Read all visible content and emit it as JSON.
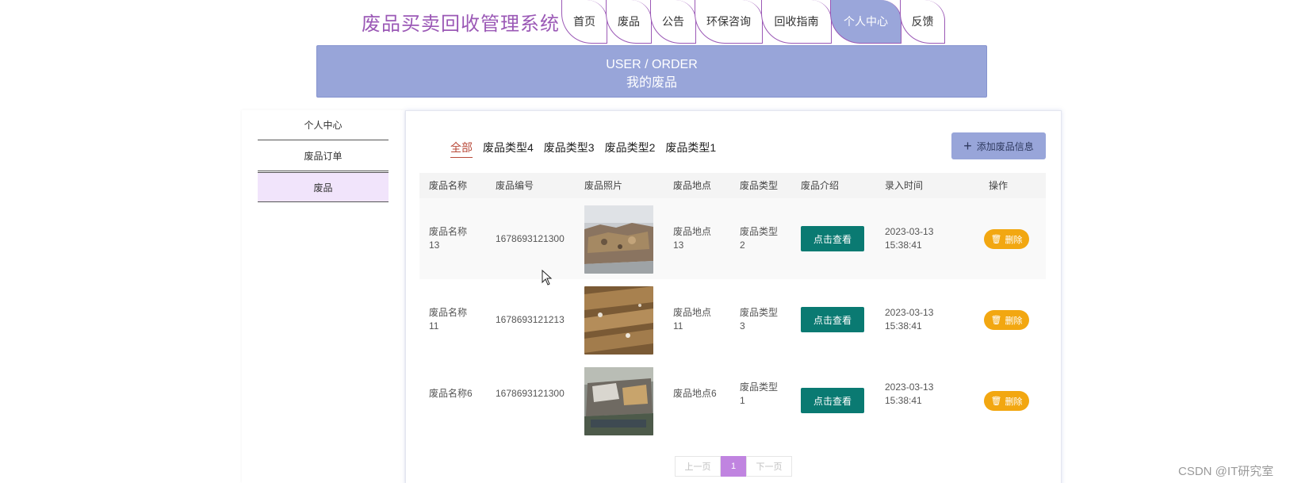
{
  "header": {
    "title": "废品买卖回收管理系统",
    "nav": [
      "首页",
      "废品",
      "公告",
      "环保咨询",
      "回收指南",
      "个人中心",
      "反馈"
    ],
    "active_nav": "个人中心"
  },
  "banner": {
    "line1": "USER / ORDER",
    "line2": "我的废品"
  },
  "sidebar": {
    "items": [
      {
        "label": "个人中心"
      },
      {
        "label": "废品订单"
      },
      {
        "label": "废品",
        "active": true
      }
    ]
  },
  "main": {
    "tabs": [
      "全部",
      "废品类型4",
      "废品类型3",
      "废品类型2",
      "废品类型1"
    ],
    "active_tab": "全部",
    "add_button": "添加废品信息",
    "columns": [
      "废品名称",
      "废品编号",
      "废品照片",
      "废品地点",
      "废品类型",
      "废品介绍",
      "录入时间",
      "操作"
    ],
    "rows": [
      {
        "name": [
          "废品名称",
          "13"
        ],
        "code": "1678693121300",
        "location": [
          "废品地点",
          "13"
        ],
        "type": [
          "废品类型",
          "2"
        ],
        "view": "点击查看",
        "time": [
          "2023-03-13",
          "15:38:41"
        ],
        "delete": "删除"
      },
      {
        "name": [
          "废品名称",
          "11"
        ],
        "code": "1678693121213",
        "location": [
          "废品地点",
          "11"
        ],
        "type": [
          "废品类型",
          "3"
        ],
        "view": "点击查看",
        "time": [
          "2023-03-13",
          "15:38:41"
        ],
        "delete": "删除"
      },
      {
        "name": [
          "废品名称6",
          ""
        ],
        "code": "1678693121300",
        "location": [
          "废品地点6",
          ""
        ],
        "type": [
          "废品类型",
          "1"
        ],
        "view": "点击查看",
        "time": [
          "2023-03-13",
          "15:38:41"
        ],
        "delete": "删除"
      }
    ],
    "pager": {
      "prev": "上一页",
      "current": "1",
      "next": "下一页"
    }
  },
  "watermark": "CSDN @IT研究室",
  "colors": {
    "brand": "#9b59b6",
    "banner": "#98a5d9",
    "view_button": "#0a7a72",
    "delete_button": "#f2a711",
    "page_current": "#c084e0"
  }
}
